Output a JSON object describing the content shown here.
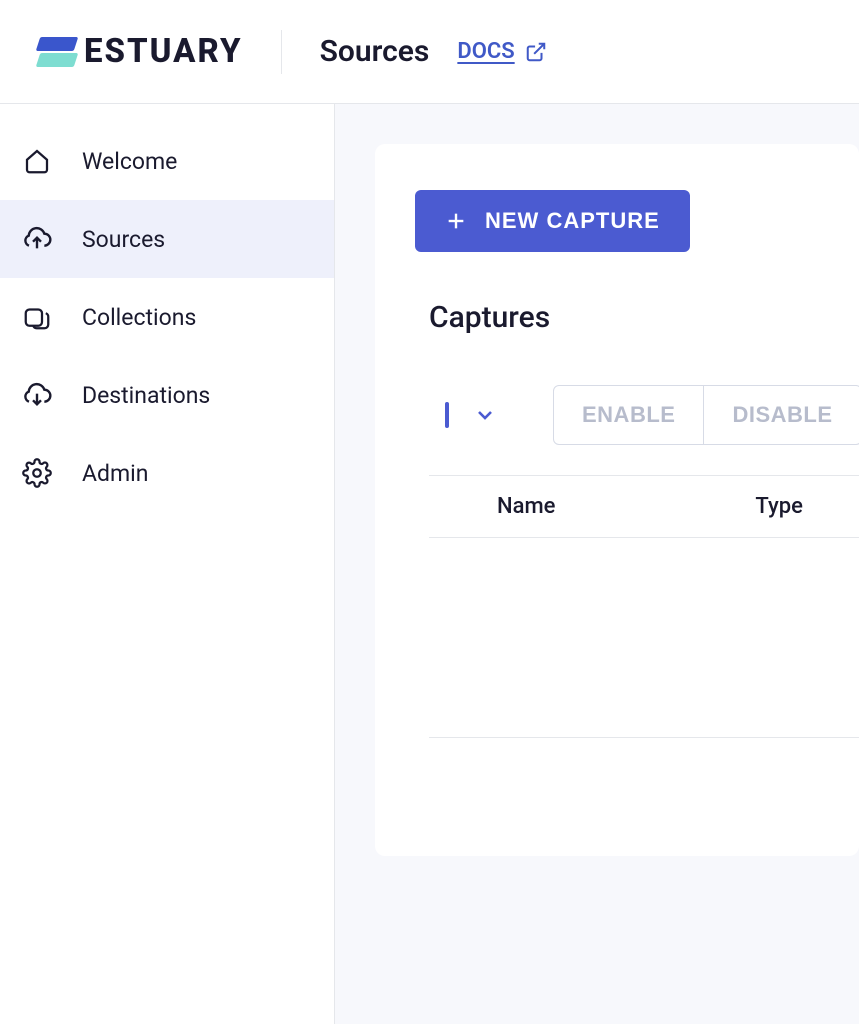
{
  "brand": {
    "name": "ESTUARY"
  },
  "header": {
    "title": "Sources",
    "docs_label": "DOCS"
  },
  "sidebar": {
    "items": [
      {
        "label": "Welcome",
        "icon": "home-icon",
        "active": false
      },
      {
        "label": "Sources",
        "icon": "cloud-up-icon",
        "active": true
      },
      {
        "label": "Collections",
        "icon": "collections-icon",
        "active": false
      },
      {
        "label": "Destinations",
        "icon": "cloud-down-icon",
        "active": false
      },
      {
        "label": "Admin",
        "icon": "gear-icon",
        "active": false
      }
    ]
  },
  "main": {
    "new_capture_label": "NEW CAPTURE",
    "section_title": "Captures",
    "toolbar": {
      "enable_label": "ENABLE",
      "disable_label": "DISABLE"
    },
    "table": {
      "columns": [
        "Name",
        "Type"
      ],
      "rows": []
    }
  },
  "colors": {
    "accent": "#4b5bd1",
    "sidebar_active_bg": "#eef0fb"
  }
}
